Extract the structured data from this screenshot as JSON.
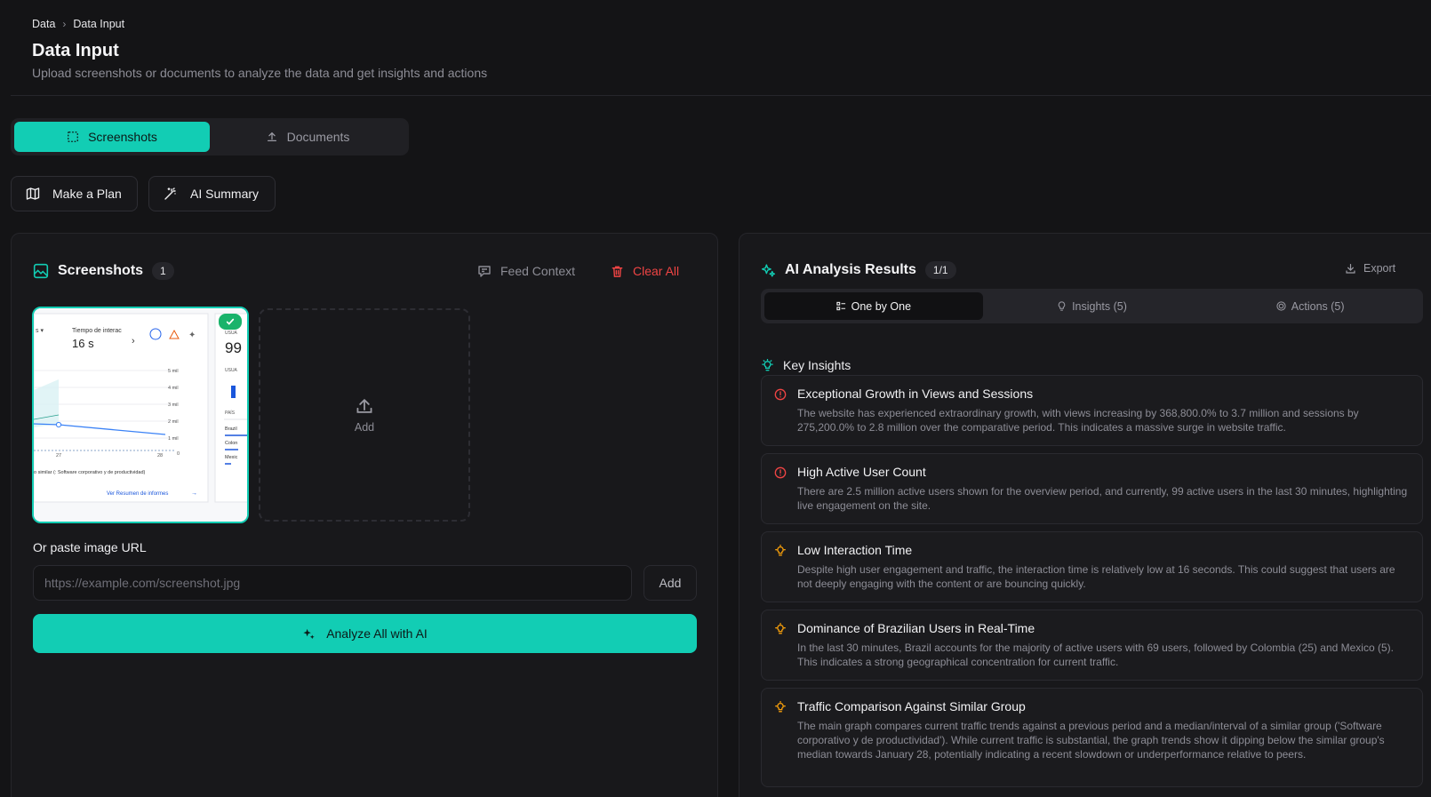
{
  "breadcrumb": {
    "root": "Data",
    "current": "Data Input"
  },
  "header": {
    "title": "Data Input",
    "subtitle": "Upload screenshots or documents to analyze the data and get insights and actions"
  },
  "tabs": {
    "screenshots": "Screenshots",
    "documents": "Documents"
  },
  "actions": {
    "make_plan": "Make a Plan",
    "ai_summary": "AI Summary"
  },
  "screenshots_panel": {
    "title": "Screenshots",
    "count": "1",
    "feed_context": "Feed Context",
    "clear_all": "Clear All",
    "add_tile": "Add",
    "url_label": "Or paste image URL",
    "url_placeholder": "https://example.com/screenshot.jpg",
    "url_add": "Add",
    "analyze": "Analyze All with AI",
    "thumbnail": {
      "metric_label": "Tiempo de interac",
      "metric_value": "16 s",
      "y_ticks": [
        "5 mil",
        "4 mil",
        "3 mil",
        "2 mil",
        "1 mil",
        "0"
      ],
      "x_ticks": [
        "27",
        "28"
      ],
      "footer_text": "o similar (: Software corporativo y de productividad)",
      "link_text": "Ver Resumen de informes",
      "side_value": "99",
      "side_label": "USUA",
      "side_label2": "PAÍS",
      "side_rows": [
        "Brazil",
        "Colon",
        "Mexic"
      ]
    }
  },
  "results_panel": {
    "title": "AI Analysis Results",
    "count": "1/1",
    "export": "Export",
    "segments": {
      "one_by_one": "One by One",
      "insights": "Insights (5)",
      "actions": "Actions (5)"
    },
    "key_insights_heading": "Key Insights",
    "insights": [
      {
        "title": "Exceptional Growth in Views and Sessions",
        "description": "The website has experienced extraordinary growth, with views increasing by 368,800.0% to 3.7 million and sessions by 275,200.0% to 2.8 million over the comparative period. This indicates a massive surge in website traffic.",
        "severity": "alert",
        "color": "#ef4444"
      },
      {
        "title": "High Active User Count",
        "description": "There are 2.5 million active users shown for the overview period, and currently, 99 active users in the last 30 minutes, highlighting live engagement on the site.",
        "severity": "alert",
        "color": "#ef4444"
      },
      {
        "title": "Low Interaction Time",
        "description": "Despite high user engagement and traffic, the interaction time is relatively low at 16 seconds. This could suggest that users are not deeply engaging with the content or are bouncing quickly.",
        "severity": "idea",
        "color": "#f59e0b"
      },
      {
        "title": "Dominance of Brazilian Users in Real-Time",
        "description": "In the last 30 minutes, Brazil accounts for the majority of active users with 69 users, followed by Colombia (25) and Mexico (5). This indicates a strong geographical concentration for current traffic.",
        "severity": "idea",
        "color": "#f59e0b"
      },
      {
        "title": "Traffic Comparison Against Similar Group",
        "description": "The main graph compares current traffic trends against a previous period and a median/interval of a similar group ('Software corporativo y de productividad'). While current traffic is substantial, the graph trends show it dipping below the similar group's median towards January 28, potentially indicating a recent slowdown or underperformance relative to peers.",
        "severity": "idea",
        "color": "#f59e0b"
      }
    ]
  },
  "colors": {
    "accent": "#12cdb4",
    "danger": "#ef4444",
    "warning": "#f59e0b",
    "success": "#19b36b"
  }
}
